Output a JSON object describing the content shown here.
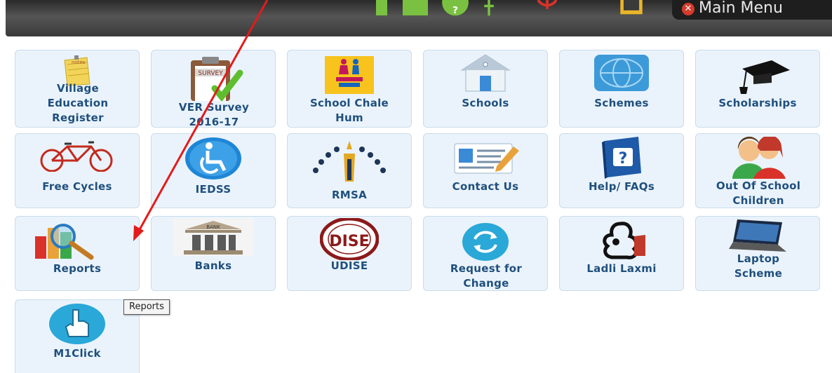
{
  "toolbar": {
    "main_menu_label": "Main Menu"
  },
  "tiles": [
    {
      "label": "Village Education Register",
      "icon": "notes-icon"
    },
    {
      "label": "VER Survey 2016-17",
      "icon": "survey-clipboard-icon"
    },
    {
      "label": "School Chale Hum",
      "icon": "school-chale-hum-logo"
    },
    {
      "label": "Schools",
      "icon": "school-building-icon"
    },
    {
      "label": "Schemes",
      "icon": "globe-icon"
    },
    {
      "label": "Scholarships",
      "icon": "graduation-cap-icon"
    },
    {
      "label": "Free Cycles",
      "icon": "bicycle-icon"
    },
    {
      "label": "IEDSS",
      "icon": "wheelchair-icon"
    },
    {
      "label": "RMSA",
      "icon": "rmsa-logo"
    },
    {
      "label": "Contact Us",
      "icon": "contact-card-icon"
    },
    {
      "label": "Help/ FAQs",
      "icon": "help-book-icon"
    },
    {
      "label": "Out Of School Children",
      "icon": "children-icon"
    },
    {
      "label": "Reports",
      "icon": "reports-chart-icon"
    },
    {
      "label": "Banks",
      "icon": "bank-building-icon"
    },
    {
      "label": "UDISE",
      "icon": "udise-seal-icon"
    },
    {
      "label": "Request for Change",
      "icon": "refresh-icon"
    },
    {
      "label": "Ladli Laxmi",
      "icon": "ladli-laxmi-logo"
    },
    {
      "label": "Laptop Scheme",
      "icon": "laptop-icon"
    },
    {
      "label": "M1Click",
      "icon": "hand-pointer-icon"
    }
  ],
  "tooltip": {
    "text": "Reports"
  }
}
